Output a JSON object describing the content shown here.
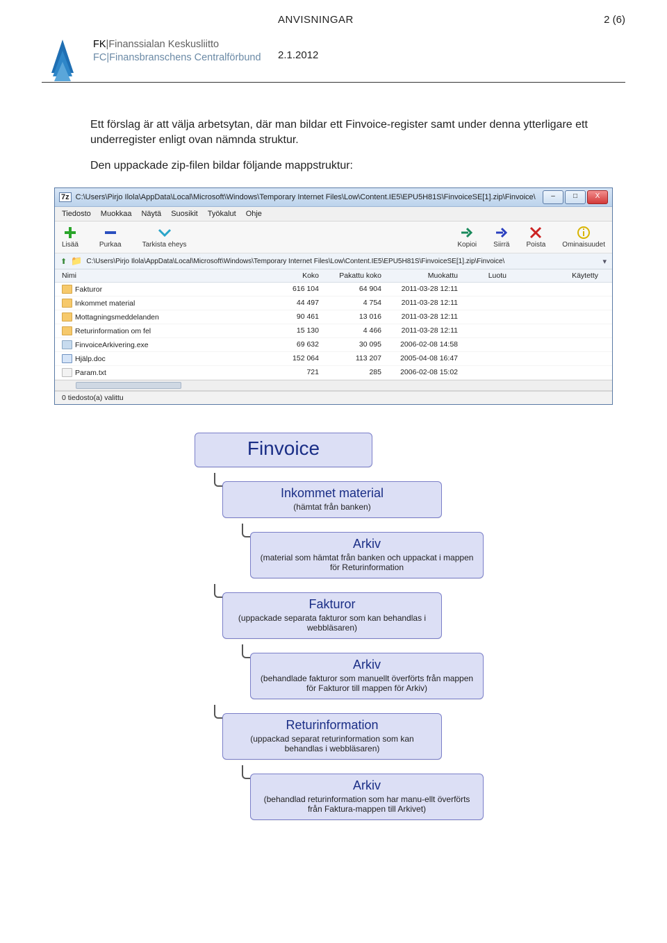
{
  "header": {
    "title": "ANVISNINGAR",
    "page_of": "2 (6)",
    "date": "2.1.2012"
  },
  "logo": {
    "line1_prefix": "FK",
    "line1_text": "Finanssialan Keskusliitto",
    "line2_prefix": "FC",
    "line2_text": "Finansbranschens Centralförbund"
  },
  "body": {
    "p1": "Ett förslag är att välja arbetsytan, där man bildar ett Finvoice-register samt under denna ytterligare ett underregister enligt ovan nämnda struktur.",
    "p2": "Den uppackade zip-filen bildar följande mappstruktur:"
  },
  "explorer": {
    "title_icon": "7z",
    "title_path": "C:\\Users\\Pirjo Ilola\\AppData\\Local\\Microsoft\\Windows\\Temporary Internet Files\\Low\\Content.IE5\\EPU5H81S\\FinvoiceSE[1].zip\\Finvoice\\",
    "menu": [
      "Tiedosto",
      "Muokkaa",
      "Näytä",
      "Suosikit",
      "Työkalut",
      "Ohje"
    ],
    "toolbar_left": [
      {
        "name": "add-icon",
        "label": "Lisää",
        "color": "#2aa52a"
      },
      {
        "name": "extract-icon",
        "label": "Purkaa",
        "color": "#2a4fbf"
      },
      {
        "name": "test-icon",
        "label": "Tarkista eheys",
        "color": "#2aa5c9"
      }
    ],
    "toolbar_right": [
      {
        "name": "copy-icon",
        "label": "Kopioi",
        "color": "#1a8a5c"
      },
      {
        "name": "move-icon",
        "label": "Siirrä",
        "color": "#2a3fbf"
      },
      {
        "name": "delete-icon",
        "label": "Poista",
        "color": "#c22"
      },
      {
        "name": "properties-icon",
        "label": "Ominaisuudet",
        "color": "#d8b400"
      }
    ],
    "addr": "C:\\Users\\Pirjo Ilola\\AppData\\Local\\Microsoft\\Windows\\Temporary Internet Files\\Low\\Content.IE5\\EPU5H81S\\FinvoiceSE[1].zip\\Finvoice\\",
    "cols": [
      "Nimi",
      "Koko",
      "Pakattu koko",
      "Muokattu",
      "Luotu",
      "Käytetty"
    ],
    "rows": [
      {
        "icon": "folder",
        "name": "Fakturor",
        "size": "616 104",
        "packed": "64 904",
        "mod": "2011-03-28 12:11"
      },
      {
        "icon": "folder",
        "name": "Inkommet material",
        "size": "44 497",
        "packed": "4 754",
        "mod": "2011-03-28 12:11"
      },
      {
        "icon": "folder",
        "name": "Mottagningsmeddelanden",
        "size": "90 461",
        "packed": "13 016",
        "mod": "2011-03-28 12:11"
      },
      {
        "icon": "folder",
        "name": "Returinformation om fel",
        "size": "15 130",
        "packed": "4 466",
        "mod": "2011-03-28 12:11"
      },
      {
        "icon": "exe",
        "name": "FinvoiceArkivering.exe",
        "size": "69 632",
        "packed": "30 095",
        "mod": "2006-02-08 14:58"
      },
      {
        "icon": "doc",
        "name": "Hjälp.doc",
        "size": "152 064",
        "packed": "113 207",
        "mod": "2005-04-08 16:47"
      },
      {
        "icon": "txt",
        "name": "Param.txt",
        "size": "721",
        "packed": "285",
        "mod": "2006-02-08 15:02"
      }
    ],
    "status": "0 tiedosto(a) valittu",
    "win_minimize": "–",
    "win_maximize": "□",
    "win_close": "X"
  },
  "diagram": {
    "root": {
      "title": "Finvoice"
    },
    "n1": {
      "title": "Inkommet material",
      "sub": "(hämtat från banken)"
    },
    "n1a": {
      "title": "Arkiv",
      "sub": "(material som hämtat från banken och uppackat i  mappen för Returinformation"
    },
    "n2": {
      "title": "Fakturor",
      "sub": "(uppackade separata fakturor som kan behandlas i webbläsaren)"
    },
    "n2a": {
      "title": "Arkiv",
      "sub": "(behandlade fakturor som manuellt överförts från mappen för Fakturor till mappen för Arkiv)"
    },
    "n3": {
      "title": "Returinformation",
      "sub": "(uppackad separat returinformation som kan behandlas i webbläsaren)"
    },
    "n3a": {
      "title": "Arkiv",
      "sub": "(behandlad returinformation som har  manu-ellt överförts från Faktura-mappen till Arkivet)"
    }
  }
}
